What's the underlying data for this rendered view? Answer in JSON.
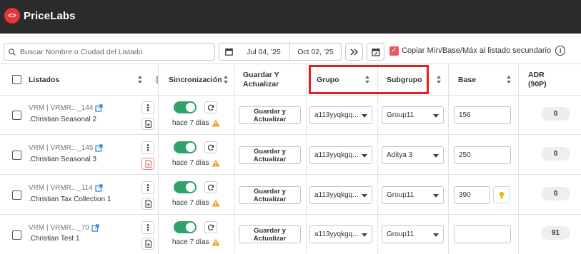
{
  "app": {
    "brand": "PriceLabs"
  },
  "toolbar": {
    "search_placeholder": "Buscar Nombre o Ciudad del Listado",
    "date_from": "Jul 04, '25",
    "date_to": "Oct 02, '25",
    "copy_label": "Copiar Mín/Base/Máx al listado secundario",
    "copy_checked": true
  },
  "columns": {
    "listados": "Listados",
    "sincronizacion": "Sincronización",
    "guardar": "Guardar Y Actualizar",
    "grupo": "Grupo",
    "subgrupo": "Subgrupo",
    "base": "Base",
    "adr": "ADR (90P)"
  },
  "rows": [
    {
      "name": "VRM | VRMR..._144",
      "sub": ".Christian Seasonal 2",
      "sync": "hace 7 días",
      "save": "Guardar y Actualizar",
      "group": "a113yyqkgq...",
      "subgroup": "Group11",
      "base": "156",
      "adr": "0"
    },
    {
      "name": "VRM | VRMR..._145",
      "sub": ".Christian Seasonal 3",
      "sync": "hace 7 días",
      "save": "Guardar y Actualizar",
      "group": "a113yyqkgq...",
      "subgroup": "Aditya 3",
      "base": "250",
      "adr": "0"
    },
    {
      "name": "VRM | VRMR..._114",
      "sub": ".Christian Tax Collection 1",
      "sync": "hace 7 días",
      "save": "Guardar y Actualizar",
      "group": "a113yyqkgq...",
      "subgroup": "Group11",
      "base": "390",
      "adr": "0"
    },
    {
      "name": "VRM | VRMR..._70",
      "sub": ".Christian Test 1",
      "sync": "hace 7 días",
      "save": "Guardar y Actualizar",
      "group": "a113yyqkgq...",
      "subgroup": "Group11",
      "base": "",
      "adr": "91"
    }
  ],
  "colors": {
    "accent": "#e5353a",
    "toggle_on": "#2fa36b",
    "highlight": "#e02020",
    "topbar": "#2b2b2b"
  }
}
